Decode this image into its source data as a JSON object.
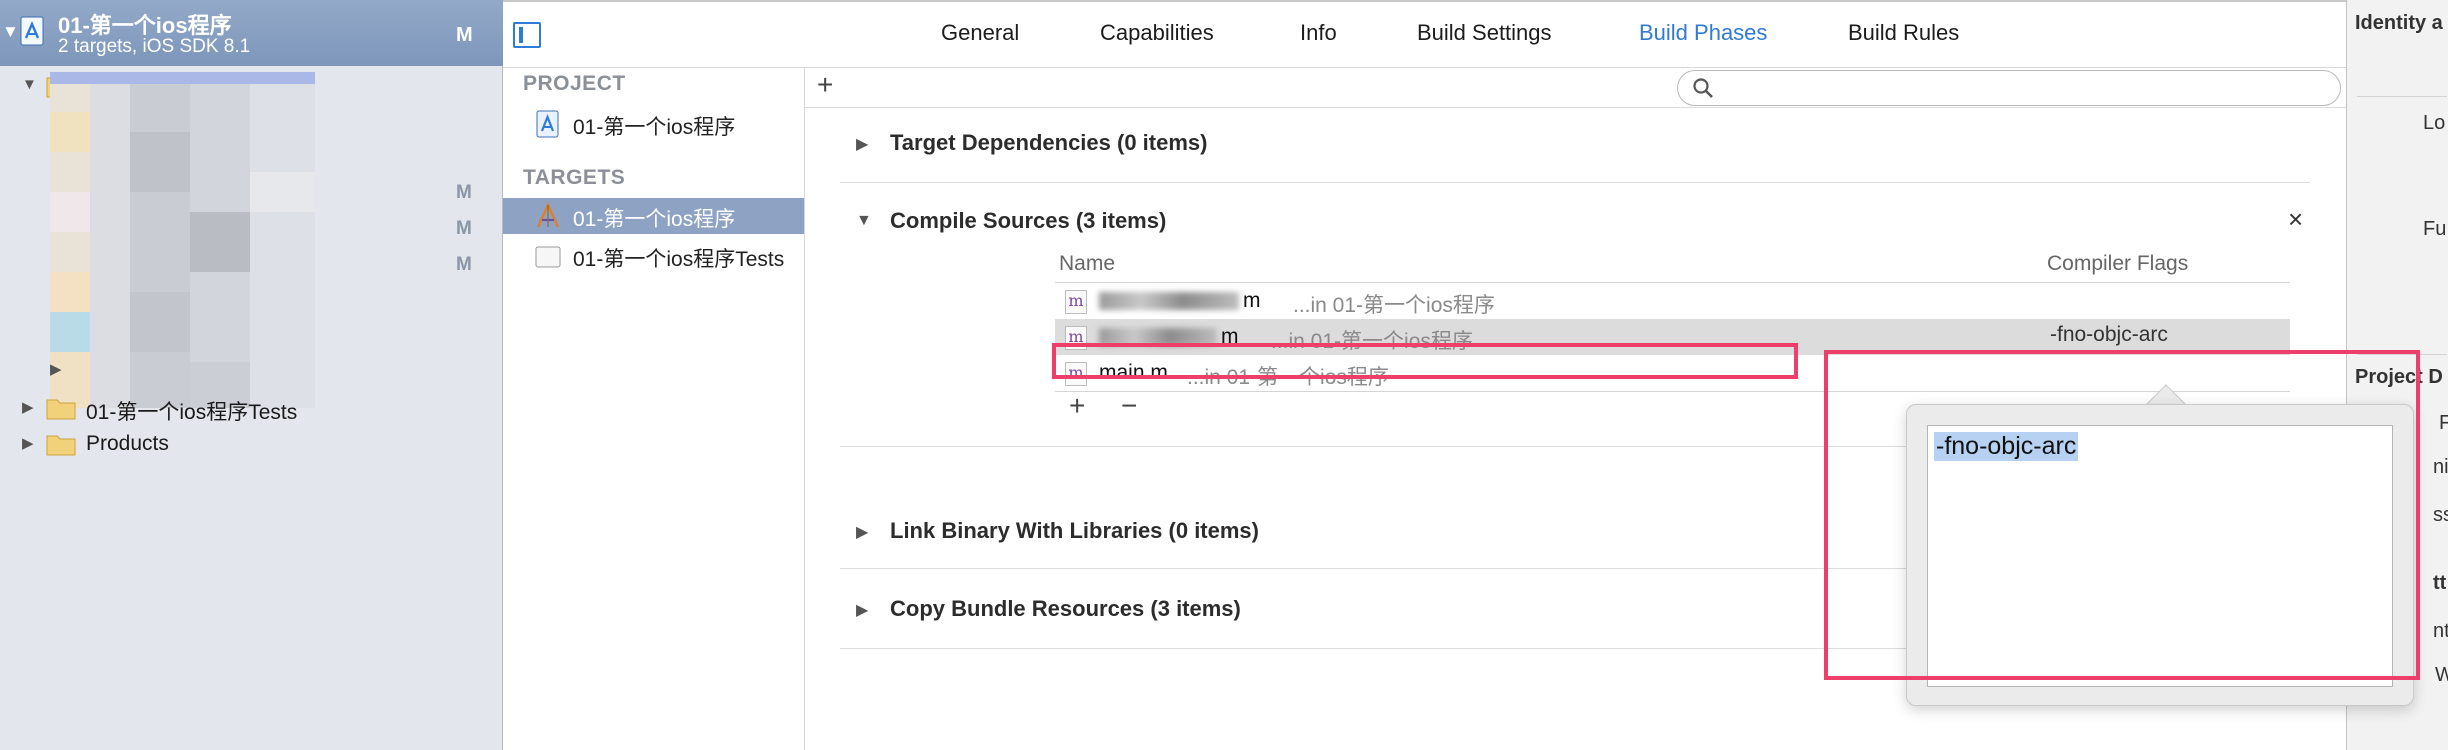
{
  "navigator": {
    "project_title": "01-第一个ios程序",
    "project_subtitle": "2 targets, iOS SDK 8.1",
    "project_badge": "M",
    "modified_badges": [
      "M",
      "M",
      "M"
    ],
    "tests_folder_label": "01-第一个ios程序Tests",
    "products_folder_label": "Products"
  },
  "tabs": [
    "General",
    "Capabilities",
    "Info",
    "Build Settings",
    "Build Phases",
    "Build Rules"
  ],
  "active_tab": "Build Phases",
  "targets_pane": {
    "project_heading": "PROJECT",
    "project_item": "01-第一个ios程序",
    "targets_heading": "TARGETS",
    "target_items": [
      "01-第一个ios程序",
      "01-第一个ios程序Tests"
    ]
  },
  "toolbar": {
    "add_label": "+"
  },
  "phases": {
    "target_dependencies": "Target Dependencies (0 items)",
    "compile_sources": "Compile Sources (3 items)",
    "link_binary": "Link Binary With Libraries (0 items)",
    "copy_bundle": "Copy Bundle Resources (3 items)",
    "close_label": "×"
  },
  "sources_table": {
    "col_name": "Name",
    "col_flags": "Compiler Flags",
    "rows": [
      {
        "file": "m",
        "location": "...in 01-第一个ios程序",
        "flags": ""
      },
      {
        "file": "m",
        "location": "...in 01-第一个ios程序",
        "flags": "-fno-objc-arc"
      },
      {
        "file": "main.m",
        "location": "...in 01-第一个ios程序",
        "flags": ""
      }
    ],
    "add_label": "+",
    "remove_label": "−"
  },
  "popover": {
    "flags_value": "-fno-objc-arc"
  },
  "inspector": {
    "identity_heading": "Identity a",
    "lo": "Lo",
    "fu": "Fu",
    "project_d": "Project D",
    "f": "F",
    "niz": "niz",
    "ss": "ss",
    "tt": "tt",
    "nt": "nt",
    "w": "W"
  },
  "colors": {
    "accent": "#2f7bd6",
    "annotation": "#ee3f6b",
    "selection": "#8ea3c3"
  }
}
